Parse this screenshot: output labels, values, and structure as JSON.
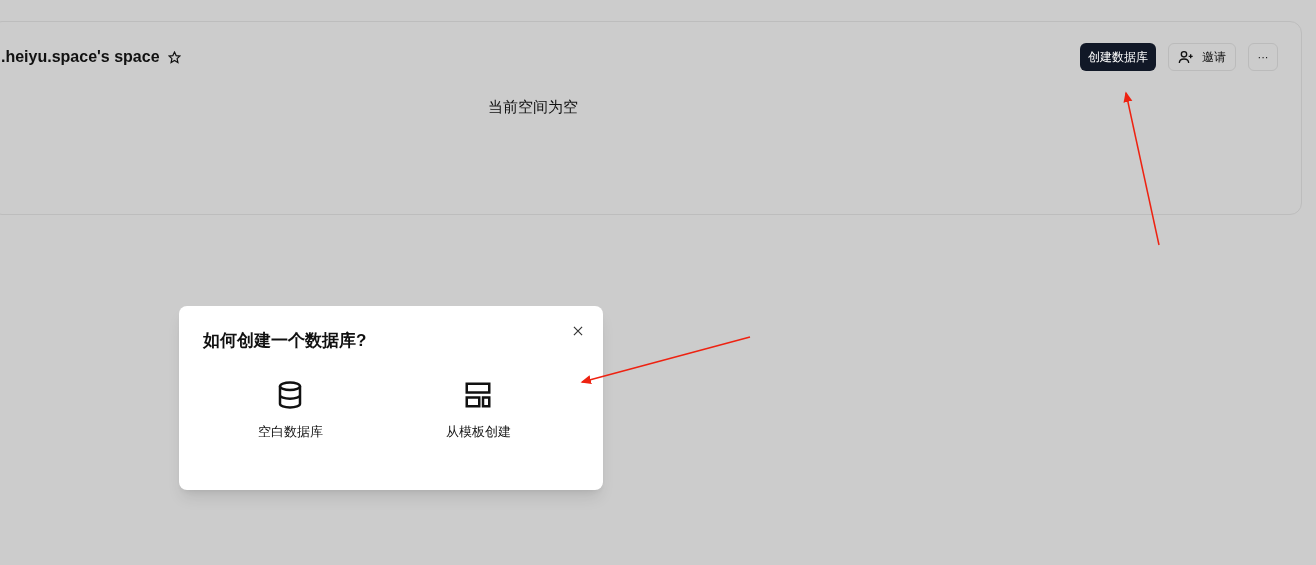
{
  "space": {
    "title": ".heiyu.space's space",
    "starred": false,
    "actions": [
      {
        "kind": "primary",
        "label": "创建数据库"
      },
      {
        "kind": "invite",
        "label": "邀请"
      },
      {
        "kind": "more",
        "label": "···"
      }
    ],
    "empty_message": "当前空间为空"
  },
  "dialog": {
    "title": "如何创建一个数据库?",
    "options": [
      {
        "kind": "blank",
        "label": "空白数据库"
      },
      {
        "kind": "template",
        "label": "从模板创建"
      }
    ]
  }
}
